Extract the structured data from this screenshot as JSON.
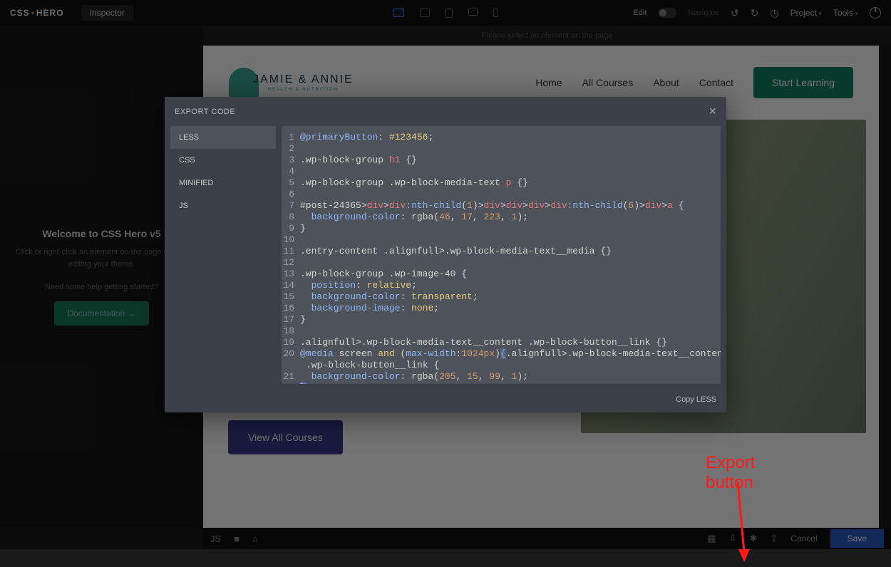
{
  "topbar": {
    "logo_a": "CSS",
    "logo_b": "HERO",
    "inspector_tab": "Inspector",
    "edit_label": "Edit",
    "navigate_label": "Navigate",
    "project_label": "Project",
    "tools_label": "Tools"
  },
  "preview": {
    "hint": "Please select an element on the page"
  },
  "sidebar": {
    "welcome_title": "Welcome to CSS Hero v5",
    "welcome_sub": "Click or right-click an element on the page to start editing your theme.",
    "welcome_help": "Need some help getting started?",
    "doc_button": "Documentation →"
  },
  "site": {
    "logo_name": "JAMIE & ANNIE",
    "logo_sub": "HEALTH & NUTRITION",
    "nav": [
      "Home",
      "All Courses",
      "About",
      "Contact"
    ],
    "cta": "Start Learning",
    "view_courses": "View All Courses"
  },
  "bottombar": {
    "js_label": "JS",
    "cancel": "Cancel",
    "save": "Save"
  },
  "modal": {
    "title": "EXPORT CODE",
    "tabs": [
      "LESS",
      "CSS",
      "MINIFIED",
      "JS"
    ],
    "copy_label": "Copy LESS",
    "code": {
      "l1_var": "@primaryButton",
      "l1_val": "#123456",
      "l3_sel": ".wp-block-group ",
      "l3_tag": "h1",
      "l5_sel": ".wp-block-group .wp-block-media-text ",
      "l5_tag": "p",
      "l7_a": "#post-24365",
      "l7_div": "div",
      "l7_nth": ":nth-child",
      "l7_n1": "1",
      "l7_n6": "6",
      "l7_a_tag": "a",
      "l8_prop": "background-color",
      "l8_fn": "rgba",
      "l8_r": "46",
      "l8_g": "17",
      "l8_b": "223",
      "l8_a": "1",
      "l12_sel": ".entry-content .alignfull>.wp-block-media-text__media",
      "l13_sel": ".wp-block-group .wp-image-40",
      "l14_prop": "position",
      "l14_val": "relative",
      "l15_prop": "background-color",
      "l15_val": "transparent",
      "l16_prop": "background-image",
      "l16_val": "none",
      "l19_sel": ".alignfull>.wp-block-media-text__content .wp-block-button__link",
      "l20_media": "@media",
      "l20_screen": "screen",
      "l20_and": "and",
      "l20_mw": "max-width",
      "l20_mwv": "1024px",
      "l20_sel": ".alignfull>.wp-block-media-text__content",
      "l20_sel2": ".wp-block-button__link",
      "l21_prop": "background-color",
      "l21_r": "205",
      "l21_g": "15",
      "l21_b": "99",
      "l21_a": "1"
    }
  },
  "annotation": {
    "label": "Export button"
  }
}
